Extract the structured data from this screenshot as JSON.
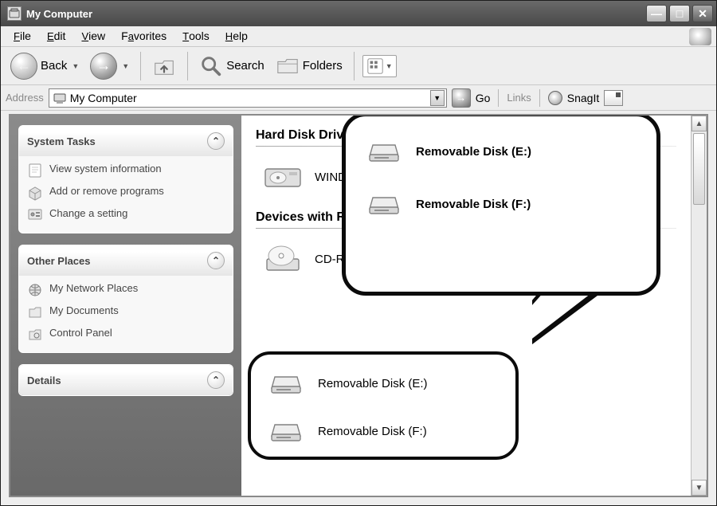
{
  "window": {
    "title": "My Computer"
  },
  "menu": {
    "file": "File",
    "edit": "Edit",
    "view": "View",
    "favorites": "Favorites",
    "tools": "Tools",
    "help": "Help"
  },
  "toolbar": {
    "back": "Back",
    "search": "Search",
    "folders": "Folders"
  },
  "address": {
    "label": "Address",
    "value": "My Computer",
    "go": "Go",
    "links": "Links",
    "snagit": "SnagIt"
  },
  "sidebar": {
    "system_tasks": {
      "title": "System Tasks",
      "items": [
        {
          "label": "View system information"
        },
        {
          "label": "Add or remove programs"
        },
        {
          "label": "Change a setting"
        }
      ]
    },
    "other_places": {
      "title": "Other Places",
      "items": [
        {
          "label": "My Network Places"
        },
        {
          "label": "My Documents"
        },
        {
          "label": "Control Panel"
        }
      ]
    },
    "details": {
      "title": "Details"
    }
  },
  "main": {
    "hdd_header": "Hard Disk Drives",
    "hdd_label_truncated": "WIND",
    "removable_header_truncated": "Devices with R",
    "cd_label": "CD-RW Drive (D:)",
    "rem_e": "Removable Disk (E:)",
    "rem_f": "Removable Disk (F:)"
  },
  "callout": {
    "rem_e": "Removable Disk (E:)",
    "rem_f": "Removable Disk (F:)"
  }
}
